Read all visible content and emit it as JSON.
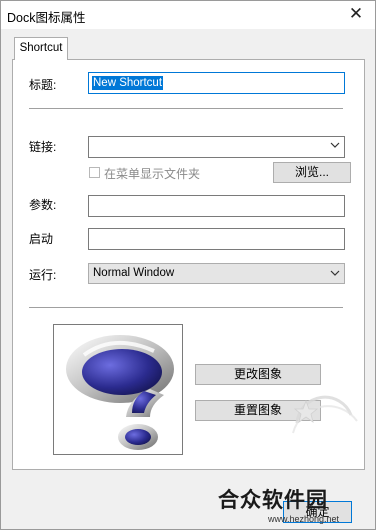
{
  "window": {
    "title": "Dock图标属性",
    "close_glyph": "✕"
  },
  "tab": {
    "label": "Shortcut"
  },
  "form": {
    "title_label": "标题:",
    "title_value": "New Shortcut",
    "link_label": "链接:",
    "link_value": "",
    "show_in_menu_label": "在菜单显示文件夹",
    "show_in_menu_checked": false,
    "browse_label": "浏览...",
    "params_label": "参数:",
    "params_value": "",
    "start_label": "启动",
    "start_value": "",
    "run_label": "运行:",
    "run_value": "Normal Window"
  },
  "icon_buttons": {
    "change_label": "更改图象",
    "reset_label": "重置图象"
  },
  "footer": {
    "ok_label": "确定"
  },
  "watermark": {
    "text": "合众软件园",
    "url": "www.hezhong.net"
  },
  "colors": {
    "accent": "#0078d7",
    "icon_blue": "#2b2b8f"
  },
  "icons": {
    "preview": "question-mark-3d-icon",
    "close": "close-icon",
    "dropdown": "chevron-down-icon"
  }
}
